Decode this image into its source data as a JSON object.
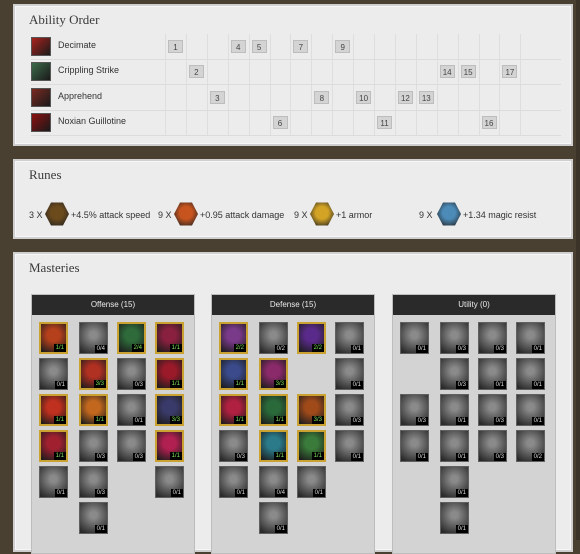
{
  "ability_order": {
    "title": "Ability Order",
    "abilities": [
      {
        "name": "Decimate",
        "levels": [
          1,
          4,
          5,
          7,
          9
        ],
        "icon": "decimate-icon",
        "color": "#a8231e"
      },
      {
        "name": "Crippling Strike",
        "levels": [
          2,
          14,
          15,
          17
        ],
        "icon": "crippling-strike-icon",
        "color": "#3d6a4b"
      },
      {
        "name": "Apprehend",
        "levels": [
          3,
          8,
          10,
          12,
          13
        ],
        "icon": "apprehend-icon",
        "color": "#7a2a22"
      },
      {
        "name": "Noxian Guillotine",
        "levels": [
          6,
          11,
          16
        ],
        "icon": "noxian-guillotine-icon",
        "color": "#8c1010"
      }
    ],
    "num_levels": 18
  },
  "runes": {
    "title": "Runes",
    "items": [
      {
        "count": "3 X",
        "desc": "+4.5% attack speed",
        "icon": "quintessence-icon",
        "color": "#6b4a1c"
      },
      {
        "count": "9 X",
        "desc": "+0.95 attack damage",
        "icon": "mark-icon",
        "color": "#c7541e"
      },
      {
        "count": "9 X",
        "desc": "+1 armor",
        "icon": "seal-icon",
        "color": "#d2a324"
      },
      {
        "count": "9 X",
        "desc": "+1.34 magic resist",
        "icon": "glyph-icon",
        "color": "#4c8bb8"
      }
    ]
  },
  "masteries": {
    "title": "Masteries",
    "trees": [
      {
        "name": "Offense (15)",
        "cells": [
          {
            "r": 0,
            "c": 0,
            "v": "1/1",
            "on": true,
            "hue": "#b5401c"
          },
          {
            "r": 0,
            "c": 1,
            "v": "0/4",
            "on": false,
            "hue": "#777"
          },
          {
            "r": 0,
            "c": 2,
            "v": "2/4",
            "on": true,
            "hue": "#2e6a3a"
          },
          {
            "r": 0,
            "c": 3,
            "v": "1/1",
            "on": true,
            "hue": "#8a2040"
          },
          {
            "r": 1,
            "c": 0,
            "v": "0/1",
            "on": false,
            "hue": "#777"
          },
          {
            "r": 1,
            "c": 1,
            "v": "3/3",
            "on": true,
            "hue": "#b03022"
          },
          {
            "r": 1,
            "c": 2,
            "v": "0/3",
            "on": false,
            "hue": "#777"
          },
          {
            "r": 1,
            "c": 3,
            "v": "1/1",
            "on": true,
            "hue": "#9a1a2a"
          },
          {
            "r": 2,
            "c": 0,
            "v": "1/1",
            "on": true,
            "hue": "#c0301e"
          },
          {
            "r": 2,
            "c": 1,
            "v": "1/1",
            "on": true,
            "hue": "#c2681e"
          },
          {
            "r": 2,
            "c": 2,
            "v": "0/1",
            "on": false,
            "hue": "#777"
          },
          {
            "r": 2,
            "c": 3,
            "v": "3/3",
            "on": true,
            "hue": "#3a3a6a"
          },
          {
            "r": 3,
            "c": 0,
            "v": "1/1",
            "on": true,
            "hue": "#a02030"
          },
          {
            "r": 3,
            "c": 1,
            "v": "0/3",
            "on": false,
            "hue": "#777"
          },
          {
            "r": 3,
            "c": 2,
            "v": "0/3",
            "on": false,
            "hue": "#777"
          },
          {
            "r": 3,
            "c": 3,
            "v": "1/1",
            "on": true,
            "hue": "#b02050"
          },
          {
            "r": 4,
            "c": 0,
            "v": "0/1",
            "on": false,
            "hue": "#777"
          },
          {
            "r": 4,
            "c": 1,
            "v": "0/3",
            "on": false,
            "hue": "#777"
          },
          {
            "r": 4,
            "c": 3,
            "v": "0/1",
            "on": false,
            "hue": "#777"
          },
          {
            "r": 5,
            "c": 1,
            "v": "0/1",
            "on": false,
            "hue": "#777"
          }
        ]
      },
      {
        "name": "Defense (15)",
        "cells": [
          {
            "r": 0,
            "c": 0,
            "v": "2/2",
            "on": true,
            "hue": "#7a3a8a"
          },
          {
            "r": 0,
            "c": 1,
            "v": "0/2",
            "on": false,
            "hue": "#777"
          },
          {
            "r": 0,
            "c": 2,
            "v": "2/2",
            "on": true,
            "hue": "#5a2a8a"
          },
          {
            "r": 0,
            "c": 3,
            "v": "0/1",
            "on": false,
            "hue": "#777"
          },
          {
            "r": 1,
            "c": 0,
            "v": "1/1",
            "on": true,
            "hue": "#3a4a8a"
          },
          {
            "r": 1,
            "c": 1,
            "v": "3/3",
            "on": true,
            "hue": "#8a2a6a"
          },
          {
            "r": 1,
            "c": 3,
            "v": "0/1",
            "on": false,
            "hue": "#777"
          },
          {
            "r": 2,
            "c": 0,
            "v": "1/1",
            "on": true,
            "hue": "#b02040"
          },
          {
            "r": 2,
            "c": 1,
            "v": "1/1",
            "on": true,
            "hue": "#2a6a3a"
          },
          {
            "r": 2,
            "c": 2,
            "v": "3/3",
            "on": true,
            "hue": "#a04a1a"
          },
          {
            "r": 2,
            "c": 3,
            "v": "0/3",
            "on": false,
            "hue": "#777"
          },
          {
            "r": 3,
            "c": 0,
            "v": "0/3",
            "on": false,
            "hue": "#777"
          },
          {
            "r": 3,
            "c": 1,
            "v": "1/1",
            "on": true,
            "hue": "#2a7a8a"
          },
          {
            "r": 3,
            "c": 2,
            "v": "1/1",
            "on": true,
            "hue": "#3a7a3a"
          },
          {
            "r": 3,
            "c": 3,
            "v": "0/1",
            "on": false,
            "hue": "#777"
          },
          {
            "r": 4,
            "c": 0,
            "v": "0/1",
            "on": false,
            "hue": "#777"
          },
          {
            "r": 4,
            "c": 1,
            "v": "0/4",
            "on": false,
            "hue": "#777"
          },
          {
            "r": 4,
            "c": 2,
            "v": "0/1",
            "on": false,
            "hue": "#777"
          },
          {
            "r": 5,
            "c": 1,
            "v": "0/1",
            "on": false,
            "hue": "#777"
          }
        ]
      },
      {
        "name": "Utility (0)",
        "cells": [
          {
            "r": 0,
            "c": 0,
            "v": "0/1",
            "on": false,
            "hue": "#777"
          },
          {
            "r": 0,
            "c": 1,
            "v": "0/3",
            "on": false,
            "hue": "#777"
          },
          {
            "r": 0,
            "c": 2,
            "v": "0/3",
            "on": false,
            "hue": "#777"
          },
          {
            "r": 0,
            "c": 3,
            "v": "0/1",
            "on": false,
            "hue": "#777"
          },
          {
            "r": 1,
            "c": 1,
            "v": "0/3",
            "on": false,
            "hue": "#777"
          },
          {
            "r": 1,
            "c": 2,
            "v": "0/1",
            "on": false,
            "hue": "#777"
          },
          {
            "r": 1,
            "c": 3,
            "v": "0/1",
            "on": false,
            "hue": "#777"
          },
          {
            "r": 2,
            "c": 0,
            "v": "0/3",
            "on": false,
            "hue": "#777"
          },
          {
            "r": 2,
            "c": 1,
            "v": "0/1",
            "on": false,
            "hue": "#777"
          },
          {
            "r": 2,
            "c": 2,
            "v": "0/3",
            "on": false,
            "hue": "#777"
          },
          {
            "r": 2,
            "c": 3,
            "v": "0/1",
            "on": false,
            "hue": "#777"
          },
          {
            "r": 3,
            "c": 0,
            "v": "0/1",
            "on": false,
            "hue": "#777"
          },
          {
            "r": 3,
            "c": 1,
            "v": "0/1",
            "on": false,
            "hue": "#777"
          },
          {
            "r": 3,
            "c": 2,
            "v": "0/3",
            "on": false,
            "hue": "#777"
          },
          {
            "r": 3,
            "c": 3,
            "v": "0/2",
            "on": false,
            "hue": "#777"
          },
          {
            "r": 4,
            "c": 1,
            "v": "0/1",
            "on": false,
            "hue": "#777"
          },
          {
            "r": 5,
            "c": 1,
            "v": "0/1",
            "on": false,
            "hue": "#777"
          }
        ]
      }
    ]
  }
}
